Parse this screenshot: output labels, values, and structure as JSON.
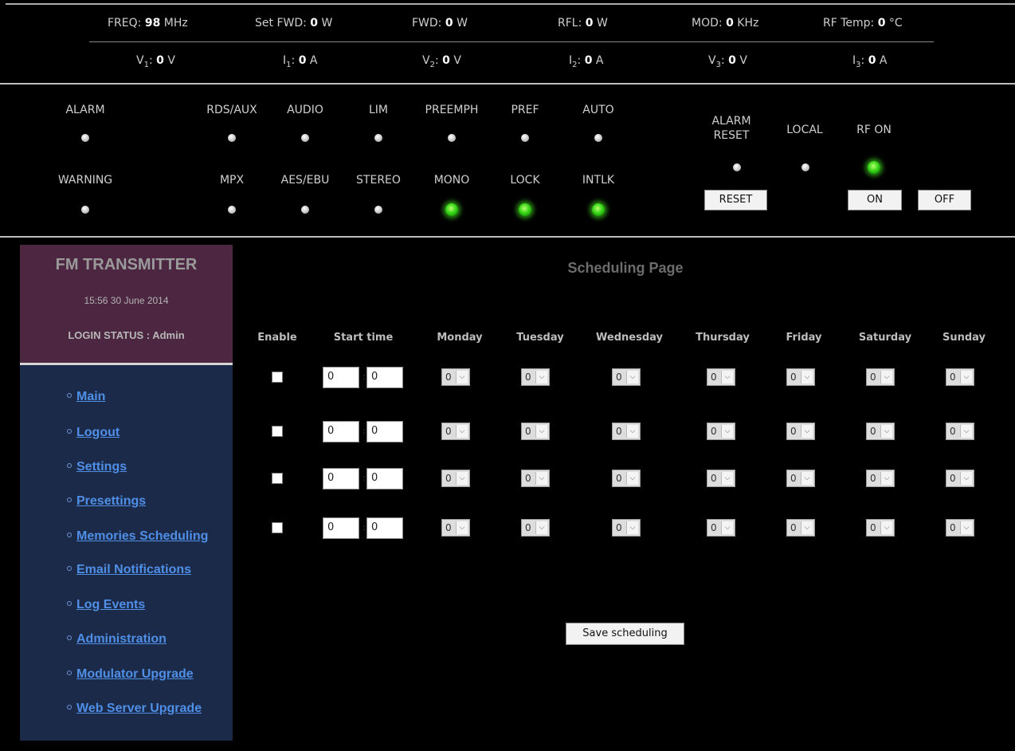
{
  "measurements_row1": [
    {
      "label": "FREQ:",
      "value": "98",
      "unit": "MHz"
    },
    {
      "label": "Set FWD:",
      "value": "0",
      "unit": "W"
    },
    {
      "label": "FWD:",
      "value": "0",
      "unit": "W"
    },
    {
      "label": "RFL:",
      "value": "0",
      "unit": "W"
    },
    {
      "label": "MOD:",
      "value": "0",
      "unit": "KHz"
    },
    {
      "label": "RF Temp:",
      "value": "0",
      "unit": "°C"
    }
  ],
  "measurements_row2": [
    {
      "label": "V",
      "sub": "1",
      "colon": ":",
      "value": "0",
      "unit": "V"
    },
    {
      "label": "I",
      "sub": "1",
      "colon": ":",
      "value": "0",
      "unit": "A"
    },
    {
      "label": "V",
      "sub": "2",
      "colon": ":",
      "value": "0",
      "unit": "V"
    },
    {
      "label": "I",
      "sub": "2",
      "colon": ":",
      "value": "0",
      "unit": "A"
    },
    {
      "label": "V",
      "sub": "3",
      "colon": ":",
      "value": "0",
      "unit": "V"
    },
    {
      "label": "I",
      "sub": "3",
      "colon": ":",
      "value": "0",
      "unit": "A"
    }
  ],
  "indicators": [
    {
      "label": "ALARM",
      "on": false
    },
    {
      "label": "RDS/AUX",
      "on": false
    },
    {
      "label": "AUDIO",
      "on": false
    },
    {
      "label": "LIM",
      "on": false
    },
    {
      "label": "PREEMPH",
      "on": false
    },
    {
      "label": "PREF",
      "on": false
    },
    {
      "label": "AUTO",
      "on": false
    },
    {
      "label": "WARNING",
      "on": false
    },
    {
      "label": "MPX",
      "on": false
    },
    {
      "label": "AES/EBU",
      "on": false
    },
    {
      "label": "STEREO",
      "on": false
    },
    {
      "label": "MONO",
      "on": true
    },
    {
      "label": "LOCK",
      "on": true
    },
    {
      "label": "INTLK",
      "on": true
    }
  ],
  "controls": {
    "alarm_reset_label_1": "ALARM",
    "alarm_reset_label_2": "RESET",
    "local_label": "LOCAL",
    "rf_on_label": "RF ON",
    "alarm_reset_on": false,
    "local_on": false,
    "rf_on": true,
    "reset_button": "RESET",
    "on_button": "ON",
    "off_button": "OFF"
  },
  "sidebar": {
    "title": "FM TRANSMITTER",
    "datetime": "15:56 30 June 2014",
    "login_status": "LOGIN STATUS : Admin",
    "nav": [
      "Main",
      "Logout",
      "Settings",
      "Presettings",
      "Memories Scheduling",
      "Email Notifications",
      "Log Events",
      "Administration",
      "Modulator Upgrade",
      "Web Server Upgrade"
    ]
  },
  "schedule": {
    "title": "Scheduling Page",
    "columns": [
      "Enable",
      "Start time",
      "Monday",
      "Tuesday",
      "Wednesday",
      "Thursday",
      "Friday",
      "Saturday",
      "Sunday"
    ],
    "rows": [
      {
        "enabled": false,
        "hour": "0",
        "minute": "0",
        "days": [
          "0",
          "0",
          "0",
          "0",
          "0",
          "0",
          "0"
        ]
      },
      {
        "enabled": false,
        "hour": "0",
        "minute": "0",
        "days": [
          "0",
          "0",
          "0",
          "0",
          "0",
          "0",
          "0"
        ]
      },
      {
        "enabled": false,
        "hour": "0",
        "minute": "0",
        "days": [
          "0",
          "0",
          "0",
          "0",
          "0",
          "0",
          "0"
        ]
      },
      {
        "enabled": false,
        "hour": "0",
        "minute": "0",
        "days": [
          "0",
          "0",
          "0",
          "0",
          "0",
          "0",
          "0"
        ]
      }
    ],
    "save_button": "Save scheduling"
  }
}
